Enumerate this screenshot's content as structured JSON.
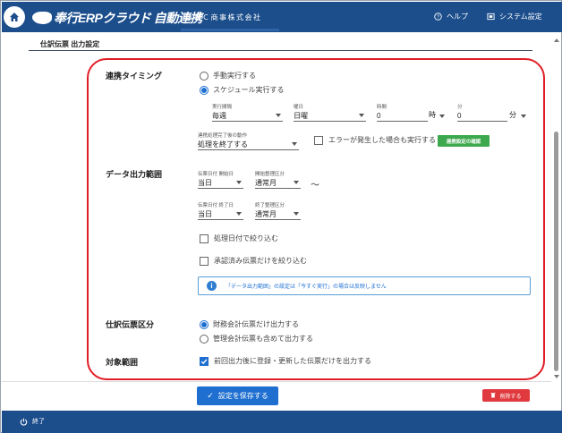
{
  "header": {
    "logo_text": "奉行ERPクラウド 自動連携",
    "company": "ＯＢＣ商事株式会社",
    "help_label": "ヘルプ",
    "settings_label": "システム設定"
  },
  "page": {
    "title": "仕訳伝票 出力設定"
  },
  "timing": {
    "section_label": "連携タイミング",
    "manual_label": "手動実行する",
    "schedule_label": "スケジュール実行する",
    "selected": "schedule",
    "cycle": {
      "label": "実行間隔",
      "value": "毎週"
    },
    "weekday": {
      "label": "曜日",
      "value": "日曜"
    },
    "hour": {
      "label": "時間",
      "value": "0",
      "unit": "時"
    },
    "minute": {
      "label": "分",
      "value": "0",
      "unit": "分"
    },
    "after": {
      "label": "連携処理完了後の動作",
      "value": "処理を終了する"
    },
    "error_run_label": "エラーが発生した場合も実行する",
    "error_run_checked": false,
    "check_button": "連携設定の確認"
  },
  "range": {
    "section_label": "データ出力範囲",
    "start_date": {
      "label": "伝票日付 開始日",
      "value": "当日"
    },
    "start_period": {
      "label": "開始整理区分",
      "value": "通常月"
    },
    "tilde": "～",
    "end_date": {
      "label": "伝票日付 終了日",
      "value": "当日"
    },
    "end_period": {
      "label": "終了整理区分",
      "value": "通常月"
    },
    "filter_processing_label": "処理日付で絞り込む",
    "filter_processing_checked": false,
    "filter_approved_label": "承認済み伝票だけを絞り込む",
    "filter_approved_checked": false,
    "info_text": "「データ出力範囲」の設定は「今すぐ実行」の場合は反映しません"
  },
  "division": {
    "section_label": "仕訳伝票区分",
    "financial_label": "財務会計伝票だけ出力する",
    "management_label": "管理会計伝票も含めて出力する",
    "selected": "financial"
  },
  "target": {
    "section_label": "対象範囲",
    "updated_only_label": "前回出力後に登録・更新した伝票だけを出力する",
    "updated_only_checked": true
  },
  "footer": {
    "save_label": "設定を保存する",
    "delete_label": "削除する",
    "exit_label": "終了"
  },
  "colors": {
    "header_bg": "#1c4e8c",
    "accent": "#1f6fd0",
    "highlight": "#e11d26",
    "confirm_green": "#3ea84e",
    "delete_red": "#e0393e"
  }
}
